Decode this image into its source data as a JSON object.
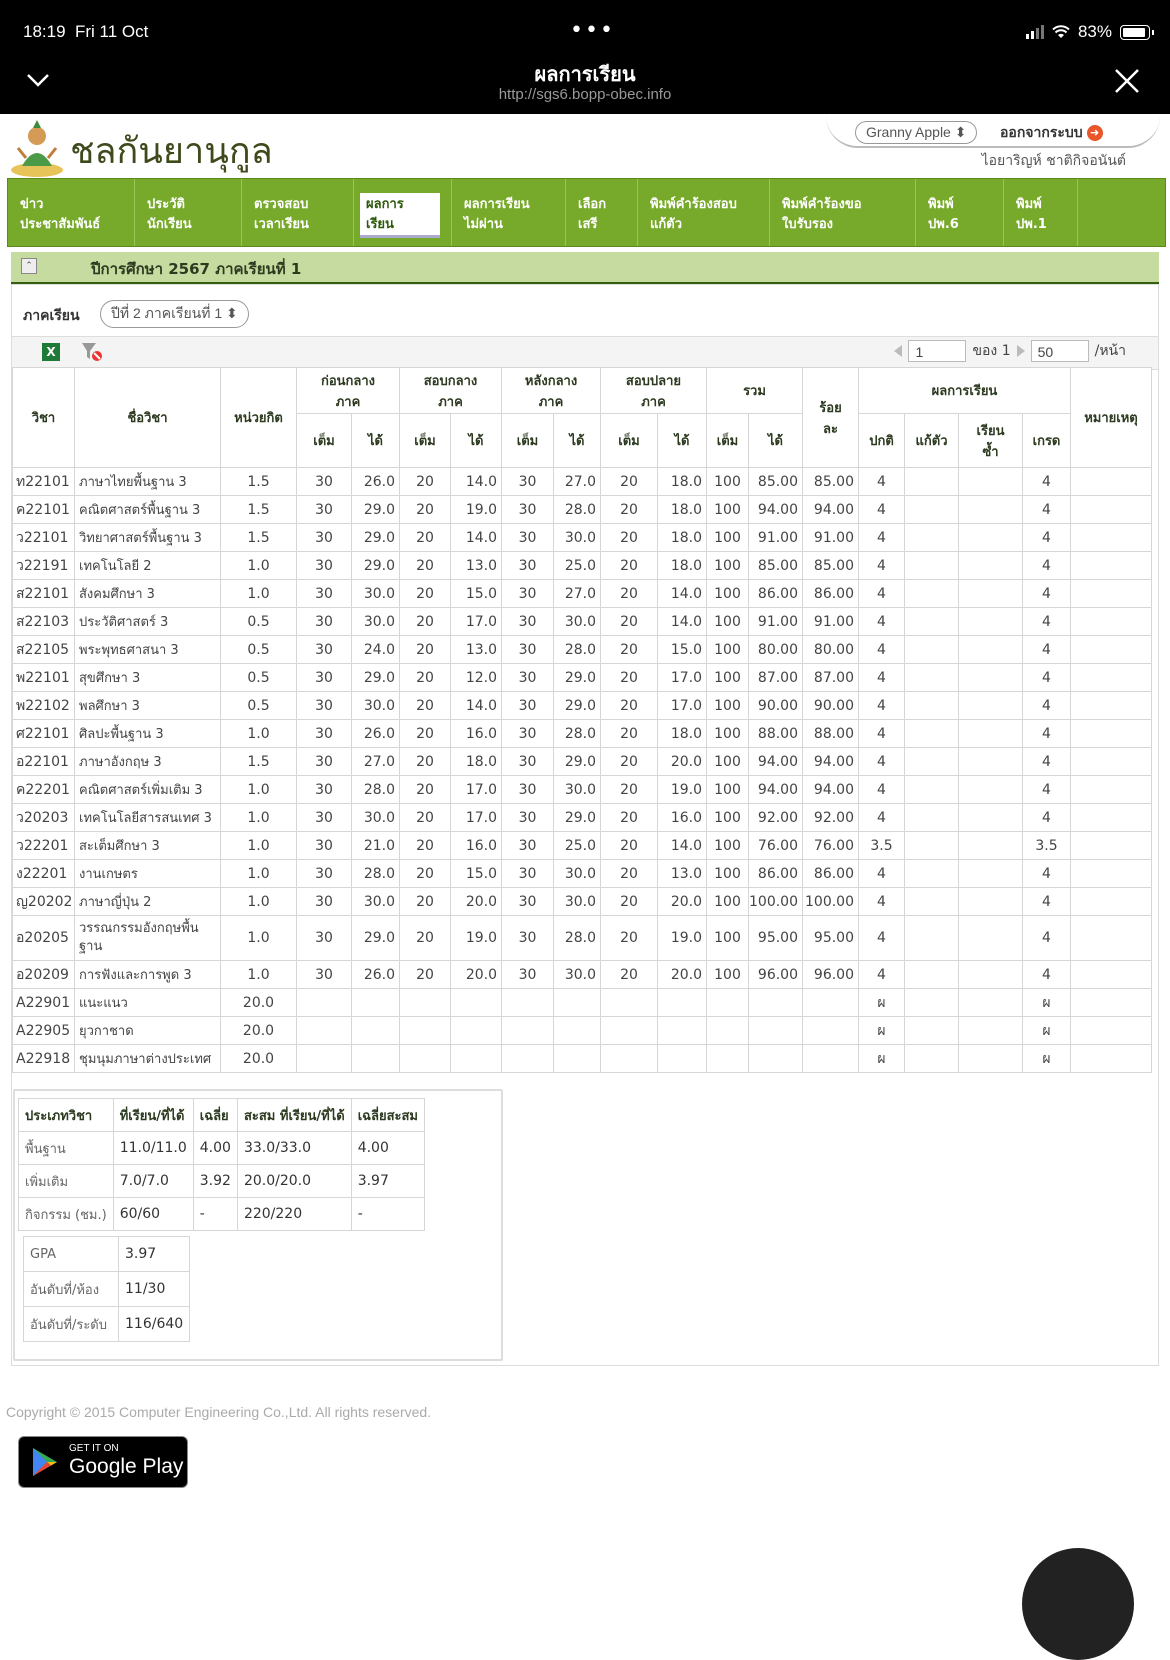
{
  "status": {
    "time": "18:19",
    "date": "Fri 11 Oct",
    "battery": "83%"
  },
  "browser": {
    "title": "ผลการเรียน",
    "url": "http://sgs6.bopp-obec.info"
  },
  "header": {
    "brand": "ชลกันยานุกูล",
    "user_select": "Granny Apple",
    "logout": "ออกจากระบบ",
    "username": "ไอยาริญห์ ชาติกิจอนันต์"
  },
  "nav": [
    {
      "l1": "ข่าว",
      "l2": "ประชาสัมพันธ์"
    },
    {
      "l1": "ประวัติ",
      "l2": "นักเรียน"
    },
    {
      "l1": "ตรวจสอบ",
      "l2": "เวลาเรียน"
    },
    {
      "l1": "ผลการ",
      "l2": "เรียน"
    },
    {
      "l1": "ผลการเรียน",
      "l2": "ไม่ผ่าน"
    },
    {
      "l1": "เลือก",
      "l2": "เสรี"
    },
    {
      "l1": "พิมพ์คำร้องสอบ",
      "l2": "แก้ตัว"
    },
    {
      "l1": "พิมพ์คำร้องขอ",
      "l2": "ใบรับรอง"
    },
    {
      "l1": "พิมพ์",
      "l2": "ปพ.6"
    },
    {
      "l1": "พิมพ์",
      "l2": "ปพ.1"
    }
  ],
  "section": {
    "title": "ปีการศึกษา 2567 ภาคเรียนที่ 1",
    "term_label": "ภาคเรียน",
    "term_value": "ปีที่ 2 ภาคเรียนที่ 1"
  },
  "pager": {
    "page": "1",
    "of_label": "ของ 1",
    "per_page": "50",
    "per_label": "/หน้า"
  },
  "table": {
    "h": {
      "code": "วิชา",
      "name": "ชื่อวิชา",
      "credit": "หน่วยกิต",
      "g1a": "ก่อนกลาง",
      "g1b": "ภาค",
      "g2a": "สอบกลาง",
      "g2b": "ภาค",
      "g3a": "หลังกลาง",
      "g3b": "ภาค",
      "g4a": "สอบปลาย",
      "g4b": "ภาค",
      "total": "รวม",
      "pct1": "ร้อย",
      "pct2": "ละ",
      "result": "ผลการเรียน",
      "note": "หมายเหตุ",
      "full": "เต็ม",
      "got": "ได้",
      "normal": "ปกติ",
      "fix": "แก้ตัว",
      "rep1": "เรียน",
      "rep2": "ซ้ำ",
      "grade": "เกรด"
    },
    "rows": [
      [
        "ท22101",
        "ภาษาไทยพื้นฐาน 3",
        "1.5",
        "30",
        "26.0",
        "20",
        "14.0",
        "30",
        "27.0",
        "20",
        "18.0",
        "100",
        "85.00",
        "85.00",
        "4",
        "",
        "",
        "4",
        ""
      ],
      [
        "ค22101",
        "คณิตศาสตร์พื้นฐาน 3",
        "1.5",
        "30",
        "29.0",
        "20",
        "19.0",
        "30",
        "28.0",
        "20",
        "18.0",
        "100",
        "94.00",
        "94.00",
        "4",
        "",
        "",
        "4",
        ""
      ],
      [
        "ว22101",
        "วิทยาศาสตร์พื้นฐาน 3",
        "1.5",
        "30",
        "29.0",
        "20",
        "14.0",
        "30",
        "30.0",
        "20",
        "18.0",
        "100",
        "91.00",
        "91.00",
        "4",
        "",
        "",
        "4",
        ""
      ],
      [
        "ว22191",
        "เทคโนโลยี 2",
        "1.0",
        "30",
        "29.0",
        "20",
        "13.0",
        "30",
        "25.0",
        "20",
        "18.0",
        "100",
        "85.00",
        "85.00",
        "4",
        "",
        "",
        "4",
        ""
      ],
      [
        "ส22101",
        "สังคมศึกษา 3",
        "1.0",
        "30",
        "30.0",
        "20",
        "15.0",
        "30",
        "27.0",
        "20",
        "14.0",
        "100",
        "86.00",
        "86.00",
        "4",
        "",
        "",
        "4",
        ""
      ],
      [
        "ส22103",
        "ประวัติศาสตร์ 3",
        "0.5",
        "30",
        "30.0",
        "20",
        "17.0",
        "30",
        "30.0",
        "20",
        "14.0",
        "100",
        "91.00",
        "91.00",
        "4",
        "",
        "",
        "4",
        ""
      ],
      [
        "ส22105",
        "พระพุทธศาสนา 3",
        "0.5",
        "30",
        "24.0",
        "20",
        "13.0",
        "30",
        "28.0",
        "20",
        "15.0",
        "100",
        "80.00",
        "80.00",
        "4",
        "",
        "",
        "4",
        ""
      ],
      [
        "พ22101",
        "สุขศึกษา 3",
        "0.5",
        "30",
        "29.0",
        "20",
        "12.0",
        "30",
        "29.0",
        "20",
        "17.0",
        "100",
        "87.00",
        "87.00",
        "4",
        "",
        "",
        "4",
        ""
      ],
      [
        "พ22102",
        "พลศึกษา 3",
        "0.5",
        "30",
        "30.0",
        "20",
        "14.0",
        "30",
        "29.0",
        "20",
        "17.0",
        "100",
        "90.00",
        "90.00",
        "4",
        "",
        "",
        "4",
        ""
      ],
      [
        "ศ22101",
        "ศิลปะพื้นฐาน 3",
        "1.0",
        "30",
        "26.0",
        "20",
        "16.0",
        "30",
        "28.0",
        "20",
        "18.0",
        "100",
        "88.00",
        "88.00",
        "4",
        "",
        "",
        "4",
        ""
      ],
      [
        "อ22101",
        "ภาษาอังกฤษ 3",
        "1.5",
        "30",
        "27.0",
        "20",
        "18.0",
        "30",
        "29.0",
        "20",
        "20.0",
        "100",
        "94.00",
        "94.00",
        "4",
        "",
        "",
        "4",
        ""
      ],
      [
        "ค22201",
        "คณิตศาสตร์เพิ่มเติม 3",
        "1.0",
        "30",
        "28.0",
        "20",
        "17.0",
        "30",
        "30.0",
        "20",
        "19.0",
        "100",
        "94.00",
        "94.00",
        "4",
        "",
        "",
        "4",
        ""
      ],
      [
        "ว20203",
        "เทคโนโลยีสารสนเทศ 3",
        "1.0",
        "30",
        "30.0",
        "20",
        "17.0",
        "30",
        "29.0",
        "20",
        "16.0",
        "100",
        "92.00",
        "92.00",
        "4",
        "",
        "",
        "4",
        ""
      ],
      [
        "ว22201",
        "สะเต็มศึกษา 3",
        "1.0",
        "30",
        "21.0",
        "20",
        "16.0",
        "30",
        "25.0",
        "20",
        "14.0",
        "100",
        "76.00",
        "76.00",
        "3.5",
        "",
        "",
        "3.5",
        ""
      ],
      [
        "ง22201",
        "งานเกษตร",
        "1.0",
        "30",
        "28.0",
        "20",
        "15.0",
        "30",
        "30.0",
        "20",
        "13.0",
        "100",
        "86.00",
        "86.00",
        "4",
        "",
        "",
        "4",
        ""
      ],
      [
        "ญ20202",
        "ภาษาญี่ปุ่น 2",
        "1.0",
        "30",
        "30.0",
        "20",
        "20.0",
        "30",
        "30.0",
        "20",
        "20.0",
        "100",
        "100.00",
        "100.00",
        "4",
        "",
        "",
        "4",
        ""
      ],
      [
        "อ20205",
        "วรรณกรรมอังกฤษพื้นฐาน",
        "1.0",
        "30",
        "29.0",
        "20",
        "19.0",
        "30",
        "28.0",
        "20",
        "19.0",
        "100",
        "95.00",
        "95.00",
        "4",
        "",
        "",
        "4",
        ""
      ],
      [
        "อ20209",
        "การฟังและการพูด 3",
        "1.0",
        "30",
        "26.0",
        "20",
        "20.0",
        "30",
        "30.0",
        "20",
        "20.0",
        "100",
        "96.00",
        "96.00",
        "4",
        "",
        "",
        "4",
        ""
      ],
      [
        "A22901",
        "แนะแนว",
        "20.0",
        "",
        "",
        "",
        "",
        "",
        "",
        "",
        "",
        "",
        "",
        "",
        "ผ",
        "",
        "",
        "ผ",
        ""
      ],
      [
        "A22905",
        "ยุวกาชาด",
        "20.0",
        "",
        "",
        "",
        "",
        "",
        "",
        "",
        "",
        "",
        "",
        "",
        "ผ",
        "",
        "",
        "ผ",
        ""
      ],
      [
        "A22918",
        "ชุมนุมภาษาต่างประเทศ",
        "20.0",
        "",
        "",
        "",
        "",
        "",
        "",
        "",
        "",
        "",
        "",
        "",
        "ผ",
        "",
        "",
        "ผ",
        ""
      ]
    ]
  },
  "summary": {
    "h": [
      "ประเภทวิชา",
      "ที่เรียน/ที่ได้",
      "เฉลี่ย",
      "สะสม ที่เรียน/ที่ได้",
      "เฉลี่ยสะสม"
    ],
    "rows": [
      [
        "พื้นฐาน",
        "11.0/11.0",
        "4.00",
        "33.0/33.0",
        "4.00"
      ],
      [
        "เพิ่มเติม",
        "7.0/7.0",
        "3.92",
        "20.0/20.0",
        "3.97"
      ],
      [
        "กิจกรรม (ชม.)",
        "60/60",
        "-",
        "220/220",
        "-"
      ]
    ],
    "gpa": [
      [
        "GPA",
        "3.97"
      ],
      [
        "อันดับที่/ห้อง",
        "11/30"
      ],
      [
        "อันดับที่/ระดับ",
        "116/640"
      ]
    ]
  },
  "footer": {
    "copyright": "Copyright © 2015 Computer Engineering Co.,Ltd. All rights reserved.",
    "gp_small": "GET IT ON",
    "gp_big": "Google Play"
  }
}
